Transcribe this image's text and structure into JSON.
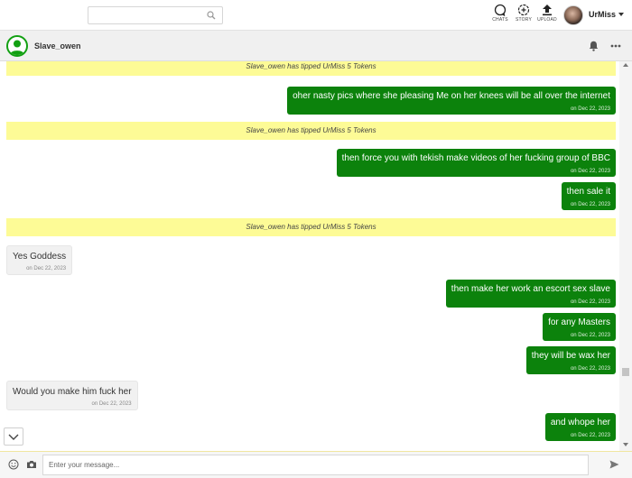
{
  "search": {
    "placeholder": "",
    "value": ""
  },
  "nav": {
    "chats_label": "CHATS",
    "story_label": "STORY",
    "upload_label": "UPLOAD"
  },
  "user": {
    "name": "UrMiss"
  },
  "chat": {
    "contact_name": "Slave_owen"
  },
  "messages": [
    {
      "type": "system",
      "text": "Slave_owen has tipped UrMiss 5 Tokens"
    },
    {
      "type": "out",
      "text": "oher nasty pics where she pleasing Me on her knees will be all over the internet",
      "time": "on Dec 22, 2023"
    },
    {
      "type": "system",
      "text": "Slave_owen has tipped UrMiss 5 Tokens"
    },
    {
      "type": "out",
      "text": "then force you with tekish make videos of her fucking group of BBC",
      "time": "on Dec 22, 2023"
    },
    {
      "type": "out",
      "text": "then sale it",
      "time": "on Dec 22, 2023"
    },
    {
      "type": "system",
      "text": "Slave_owen has tipped UrMiss 5 Tokens"
    },
    {
      "type": "in",
      "text": "Yes Goddess",
      "time": "on Dec 22, 2023"
    },
    {
      "type": "out",
      "text": "then make her work an escort sex slave",
      "time": "on Dec 22, 2023"
    },
    {
      "type": "out",
      "text": "for any Masters",
      "time": "on Dec 22, 2023"
    },
    {
      "type": "out",
      "text": "they will be wax her",
      "time": "on Dec 22, 2023"
    },
    {
      "type": "in",
      "text": "Would you make him fuck her",
      "time": "on Dec 22, 2023"
    },
    {
      "type": "out",
      "text": "and whope her",
      "time": "on Dec 22, 2023"
    }
  ],
  "composer": {
    "placeholder": "Enter your message..."
  },
  "colors": {
    "outgoing": "#0c820c",
    "system": "#fdfb96",
    "incoming": "#f1f1f1"
  }
}
